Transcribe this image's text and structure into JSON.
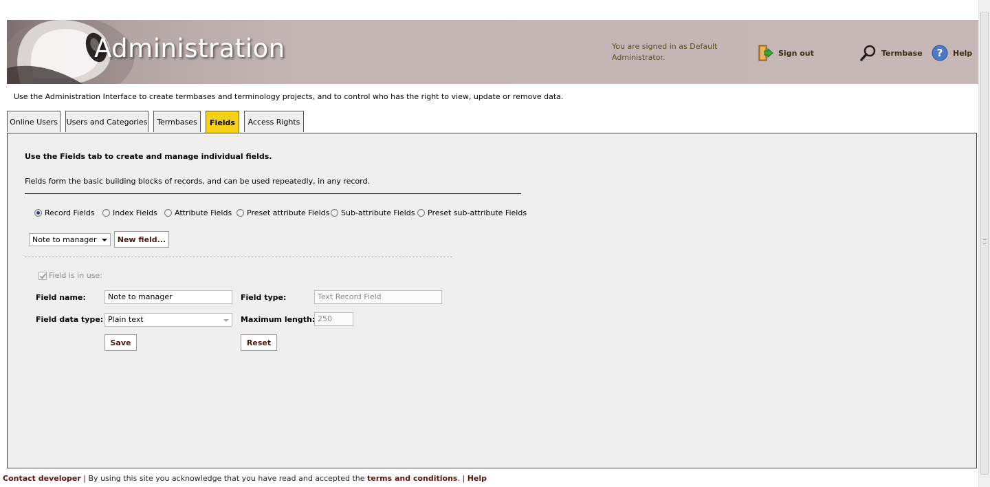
{
  "header": {
    "title": "Administration",
    "signed_in_text": "You are signed in as Default Administrator.",
    "sign_out_label": "Sign out",
    "termbase_label": "Termbase",
    "help_label": "Help"
  },
  "intro": "Use the Administration Interface to create termbases and terminology projects, and to control who has the right to view, update or remove data.",
  "tabs": [
    {
      "label": "Online Users"
    },
    {
      "label": "Users and Categories"
    },
    {
      "label": "Termbases"
    },
    {
      "label": "Fields",
      "active": true
    },
    {
      "label": "Access Rights"
    }
  ],
  "panel": {
    "heading": "Use the Fields tab to create and manage individual fields.",
    "description": "Fields form the basic building blocks of records, and can be used repeatedly, in any record.",
    "radios": [
      {
        "label": "Record Fields",
        "selected": true
      },
      {
        "label": "Index Fields"
      },
      {
        "label": "Attribute Fields"
      },
      {
        "label": "Preset attribute Fields"
      },
      {
        "label": "Sub-attribute Fields"
      },
      {
        "label": "Preset sub-attribute Fields"
      }
    ],
    "field_select_value": "Note to manager",
    "new_field_label": "New field...",
    "in_use_label": "Field is in use:",
    "form": {
      "field_name_label": "Field name:",
      "field_name_value": "Note to manager",
      "field_type_label": "Field type:",
      "field_type_value": "Text Record Field",
      "data_type_label": "Field data type:",
      "data_type_value": "Plain text",
      "max_length_label": "Maximum length:",
      "max_length_value": "250",
      "save_label": "Save",
      "reset_label": "Reset"
    }
  },
  "footer": {
    "contact_label": "Contact developer",
    "text_before": " | By using this site you acknowledge that you have read and accepted the ",
    "terms_label": "terms and conditions",
    "text_after": ". | ",
    "help_label": "Help"
  },
  "colors": {
    "active_tab": "#f7d117",
    "banner": "#c6b8b6",
    "panel_bg": "#efefef",
    "link": "#5a1410"
  }
}
